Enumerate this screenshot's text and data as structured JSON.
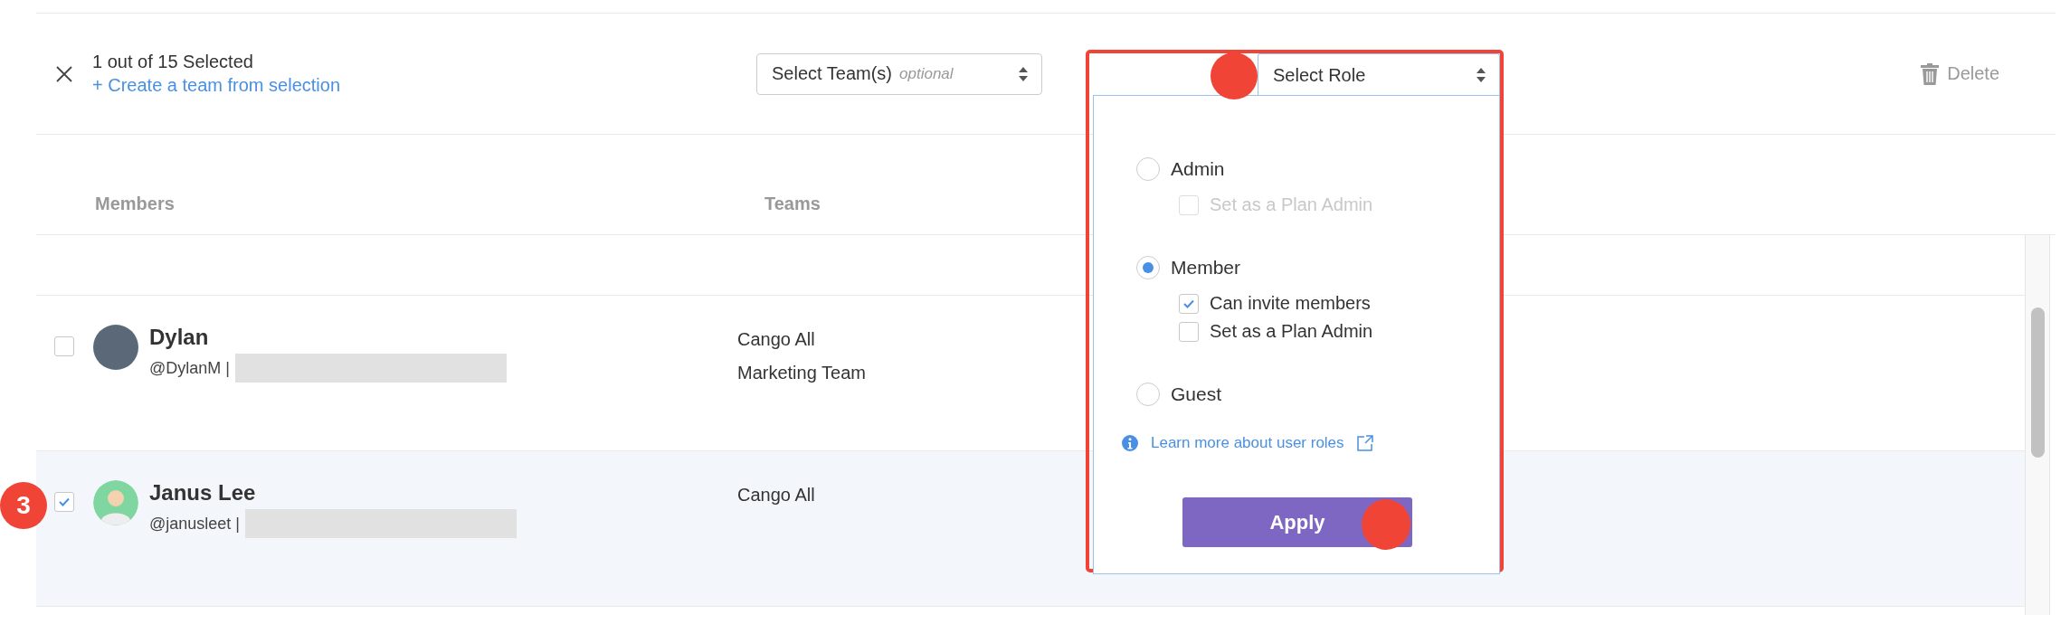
{
  "selection_bar": {
    "count_text": "1 out of 15 Selected",
    "create_link": "+ Create a team from selection",
    "team_select": {
      "label": "Select Team(s)",
      "hint": "optional"
    },
    "delete_button": "Delete"
  },
  "table": {
    "columns": [
      "Members",
      "Teams"
    ],
    "rows": [
      {
        "name": "Dylan",
        "handle": "@DylanM |",
        "avatar": {
          "kind": "photo"
        },
        "teams": [
          "Cango All",
          "Marketing Team"
        ],
        "selected": false
      },
      {
        "name": "Janus Lee",
        "handle": "@janusleet |",
        "avatar": {
          "kind": "illustration"
        },
        "teams": [
          "Cango All"
        ],
        "selected": true,
        "step_badge": "3"
      }
    ]
  },
  "role_popup": {
    "highlighted": true,
    "select_label": "Select Role",
    "select_marker": true,
    "options": [
      {
        "label": "Admin",
        "selected": false,
        "suboptions": [
          {
            "label": "Set as a Plan Admin",
            "checked": false,
            "disabled": true
          }
        ]
      },
      {
        "label": "Member",
        "selected": true,
        "suboptions": [
          {
            "label": "Can invite members",
            "checked": true,
            "disabled": false
          },
          {
            "label": "Set as a Plan Admin",
            "checked": false,
            "disabled": false
          }
        ]
      },
      {
        "label": "Guest",
        "selected": false
      }
    ],
    "help_link": "Learn more about user roles",
    "apply_button": "Apply",
    "apply_marker": true
  }
}
